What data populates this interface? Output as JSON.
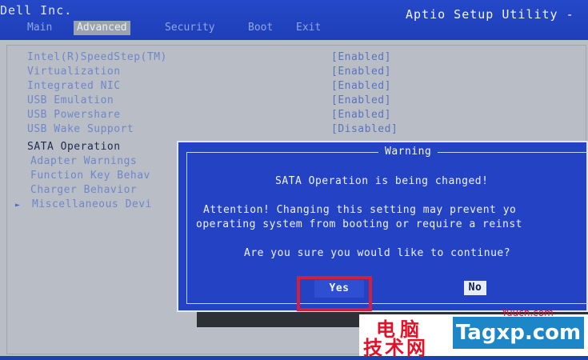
{
  "header": {
    "vendor": "Dell Inc.",
    "utility_title": "Aptio Setup Utility -",
    "tabs": [
      {
        "label": "Main"
      },
      {
        "label": "Advanced"
      },
      {
        "label": "Security"
      },
      {
        "label": "Boot"
      },
      {
        "label": "Exit"
      }
    ],
    "active_tab": "Advanced"
  },
  "settings": [
    {
      "label": "Intel(R)SpeedStep(TM)",
      "value": "[Enabled]"
    },
    {
      "label": "Virtualization",
      "value": "[Enabled]"
    },
    {
      "label": "Integrated NIC",
      "value": "[Enabled]"
    },
    {
      "label": "USB Emulation",
      "value": "[Enabled]"
    },
    {
      "label": "USB Powershare",
      "value": "[Enabled]"
    },
    {
      "label": "USB Wake Support",
      "value": "[Disabled]"
    },
    {
      "label": "SATA Operation",
      "value": ""
    },
    {
      "label": "Adapter Warnings",
      "value": ""
    },
    {
      "label": "Function Key Behav",
      "value": ""
    },
    {
      "label": "Charger Behavior",
      "value": ""
    },
    {
      "label": "Miscellaneous Devi",
      "value": ""
    }
  ],
  "selected_setting": "SATA Operation",
  "submenu_arrow": "►",
  "dialog": {
    "title": "Warning",
    "message": "SATA Operation is being changed!",
    "attention_line1": "Attention! Changing this setting may prevent yo",
    "attention_line2": "operating system from booting or require a reinst",
    "question": "Are you sure you would like to continue?",
    "yes_label": "Yes",
    "no_label": "No"
  },
  "watermark": {
    "cn_line1": "电脑",
    "cn_line2": "技术网",
    "site": "Tagxp.com",
    "small": "Yuucn.com"
  },
  "colors": {
    "bios_blue": "#2343c4",
    "grey_panel": "#b9bec6",
    "highlight_red": "#d41f3a"
  }
}
